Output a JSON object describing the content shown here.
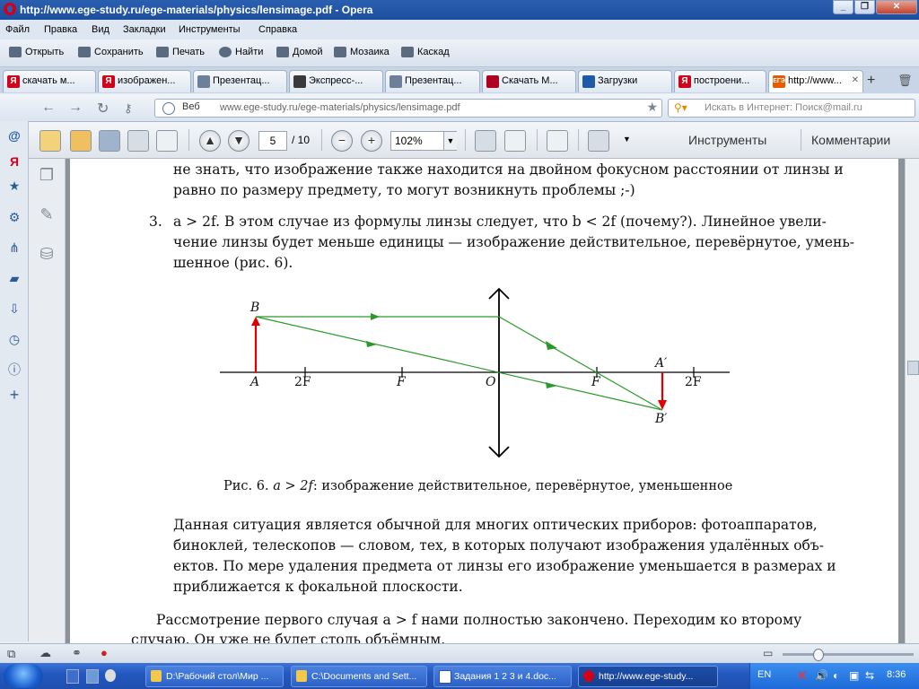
{
  "window": {
    "title": "http://www.ege-study.ru/ege-materials/physics/lensimage.pdf - Opera",
    "controls": [
      "minimize",
      "restore",
      "close"
    ]
  },
  "menu": [
    "Файл",
    "Правка",
    "Вид",
    "Закладки",
    "Инструменты",
    "Справка"
  ],
  "bookmarks_bar": [
    "Открыть",
    "Сохранить",
    "Печать",
    "Найти",
    "Домой",
    "Мозаика",
    "Каскад"
  ],
  "tabs": [
    {
      "label": "скачать м...",
      "icon": "Я",
      "color": "#d0021b"
    },
    {
      "label": "изображен...",
      "icon": "Я",
      "color": "#d0021b"
    },
    {
      "label": "Презентац...",
      "icon": "doc-icon",
      "color": "#6d7f99"
    },
    {
      "label": "Экспресс-...",
      "icon": "grid-icon",
      "color": "#3a3a3a"
    },
    {
      "label": "Презентац...",
      "icon": "doc-icon",
      "color": "#6d7f99"
    },
    {
      "label": "Скачать М...",
      "icon": "download-icon",
      "color": "#b00020"
    },
    {
      "label": "Загрузки",
      "icon": "download-icon",
      "color": "#1d5aa8"
    },
    {
      "label": "построени...",
      "icon": "Я",
      "color": "#d0021b"
    },
    {
      "label": "http://www...",
      "icon": "ЕГЭ",
      "color": "#e65a00",
      "active": true
    }
  ],
  "address": {
    "web_label": "Веб",
    "url": "www.ege-study.ru/ege-materials/physics/lensimage.pdf",
    "search_placeholder": "Искать в Интернет: Поиск@mail.ru"
  },
  "pdf_toolbar": {
    "page": "5",
    "total": "/ 10",
    "zoom": "102%",
    "tools_label": "Инструменты",
    "comments_label": "Комментарии"
  },
  "doc": {
    "line_top1": "не знать, что изображение также находится на двойном фокусном расстоянии от линзы и",
    "line_top2": "равно по размеру предмету, то могут возникнуть проблемы ;-)",
    "item_number": "3.",
    "item_line1": "a > 2f. В этом случае из формулы линзы следует, что b < 2f (почему?). Линейное увели-",
    "item_line2": "чение линзы будет меньше единицы — изображение действительное, перевёрнутое, умень-",
    "item_line3": "шенное (рис. 6).",
    "figure_labels": {
      "B": "B",
      "A": "A",
      "2F_left": "2F",
      "F_left": "F",
      "O": "O",
      "F_right": "F",
      "A_prime": "A′",
      "2F_right": "2F",
      "B_prime": "B′"
    },
    "caption_prefix": "Рис. 6.",
    "caption_math": "a > 2f",
    "caption_text": ": изображение действительное, перевёрнутое, уменьшенное",
    "para_line1": "Данная ситуация является обычной для многих оптических приборов: фотоаппаратов,",
    "para_line2": "биноклей, телескопов — словом, тех, в которых получают изображения удалённых объ-",
    "para_line3": "ектов. По мере удаления предмета от линзы его изображение уменьшается в размерах и",
    "para_line4": "приближается к фокальной плоскости.",
    "bottom_line1": "Рассмотрение первого случая a > f нами полностью закончено. Переходим ко второму",
    "bottom_line2": "случаю. Он уже не будет столь объёмным."
  },
  "taskbar": {
    "items": [
      "D:\\Рабочий стол\\Мир ...",
      "C:\\Documents and Sett...",
      "Задания 1 2 3 и 4.doc...",
      "http://www.ege-study..."
    ],
    "lang": "EN",
    "clock": "8:36"
  },
  "colors": {
    "ray": "#2a9a2a",
    "object_arrow": "#e00000",
    "titlebar": "#2a5fb0"
  }
}
